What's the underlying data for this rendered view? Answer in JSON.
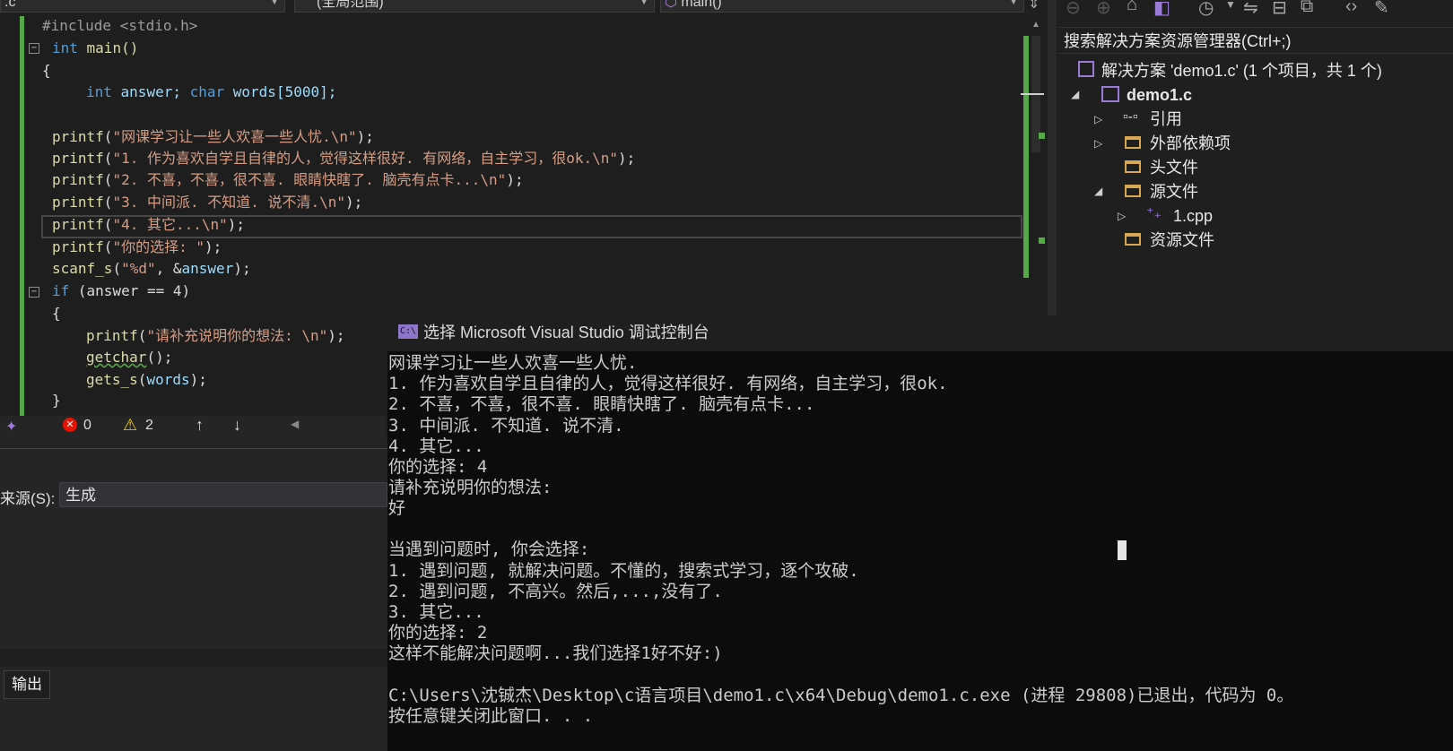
{
  "nav": {
    "file_combo": ".c",
    "scope_combo": "(全局范围)",
    "func_combo": "main()"
  },
  "code": {
    "line0": "#include <stdio.h>",
    "l1a": "int",
    "l1b": " main()",
    "l2": "{",
    "l3a": "int",
    "l3b": " answer; ",
    "l3c": "char",
    "l3d": " words[5000];",
    "p1": "\"网课学习让一些人欢喜一些人忧.\\n\"",
    "p2": "\"1. 作为喜欢自学且自律的人，觉得这样很好. 有网络，自主学习，很ok.\\n\"",
    "p3": "\"2. 不喜，不喜，很不喜. 眼睛快瞎了. 脑壳有点卡...\\n\"",
    "p4": "\"3. 中间派. 不知道. 说不清.\\n\"",
    "p5": "\"4. 其它...\\n\"",
    "p6": "\"你的选择: \"",
    "scanf_fmt": "\"%d\"",
    "if_kw": "if",
    "if_rest": " (answer == 4)",
    "brace_open": "{",
    "p7": "\"请补充说明你的想法: \\n\"",
    "getchar": "getchar",
    "gets_s": "gets_s",
    "brace_close": "}"
  },
  "status": {
    "errors": "0",
    "warnings": "2"
  },
  "output": {
    "source_label": "来源(S):",
    "source_value": "生成",
    "tab_label": "输出"
  },
  "solution": {
    "search_label": "搜索解决方案资源管理器(Ctrl+;)",
    "root": "解决方案 'demo1.c' (1 个项目，共 1 个)",
    "project": "demo1.c",
    "items": [
      "引用",
      "外部依赖项",
      "头文件",
      "源文件",
      "1.cpp",
      "资源文件"
    ]
  },
  "console": {
    "title": "选择 Microsoft Visual Studio 调试控制台",
    "lines": [
      "网课学习让一些人欢喜一些人忧.",
      "1. 作为喜欢自学且自律的人，觉得这样很好. 有网络，自主学习，很ok.",
      "2. 不喜，不喜，很不喜. 眼睛快瞎了. 脑壳有点卡...",
      "3. 中间派. 不知道. 说不清.",
      "4. 其它...",
      "你的选择: 4",
      "请补充说明你的想法:",
      "好",
      "",
      "当遇到问题时, 你会选择:",
      "1. 遇到问题, 就解决问题。不懂的，搜索式学习，逐个攻破.",
      "2. 遇到问题, 不高兴。然后,...,没有了.",
      "3. 其它...",
      "你的选择: 2",
      "这样不能解决问题啊...我们选择1好不好:)",
      "",
      "C:\\Users\\沈铖杰\\Desktop\\c语言项目\\demo1.c\\x64\\Debug\\demo1.c.exe (进程 29808)已退出，代码为 0。",
      "按任意键关闭此窗口. . ."
    ]
  }
}
